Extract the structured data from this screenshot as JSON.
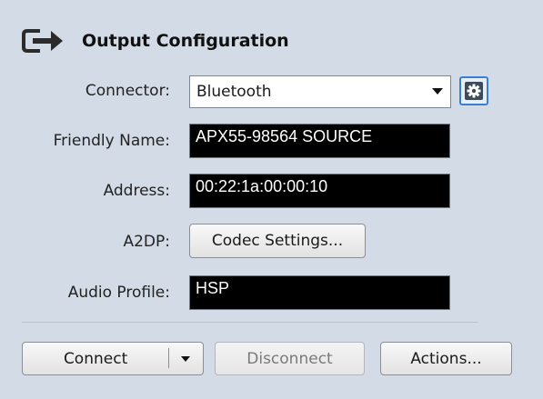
{
  "header": {
    "title": "Output Configuration",
    "icon": "output-arrow-icon"
  },
  "fields": {
    "connector": {
      "label": "Connector:",
      "value": "Bluetooth"
    },
    "friendly_name": {
      "label": "Friendly Name:",
      "value": "APX55-98564 SOURCE"
    },
    "address": {
      "label": "Address:",
      "value": "00:22:1a:00:00:10"
    },
    "a2dp": {
      "label": "A2DP:",
      "button_label": "Codec Settings..."
    },
    "audio_profile": {
      "label": "Audio Profile:",
      "value": "HSP"
    }
  },
  "actions": {
    "connect_label": "Connect",
    "disconnect_label": "Disconnect",
    "actions_label": "Actions..."
  },
  "colors": {
    "background": "#d2dbe6",
    "field_background": "#000000",
    "accent": "#3b7fd1"
  }
}
